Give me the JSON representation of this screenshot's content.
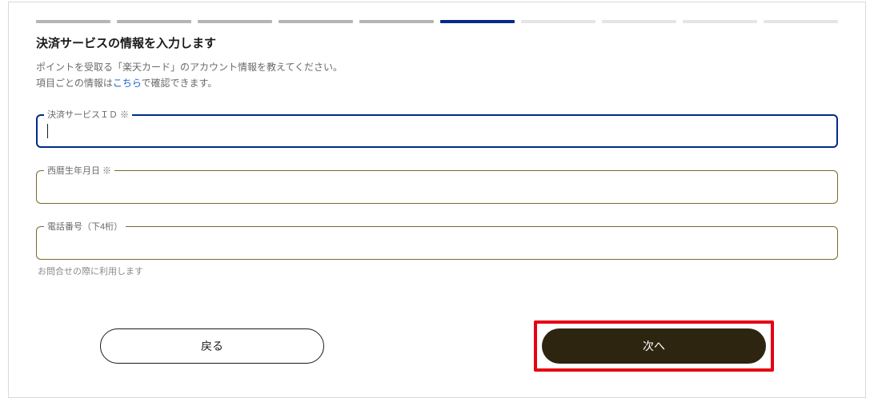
{
  "progress": {
    "total": 10,
    "current_index": 5
  },
  "title": "決済サービスの情報を入力します",
  "description": {
    "line1": "ポイントを受取る「楽天カード」のアカウント情報を教えてください。",
    "line2_prefix": "項目ごとの情報は",
    "line2_link": "こちら",
    "line2_suffix": "で確認できます。"
  },
  "fields": {
    "service_id": {
      "label": "決済サービスＩＤ ※",
      "value": ""
    },
    "birthdate": {
      "label": "西暦生年月日 ※",
      "value": ""
    },
    "phone": {
      "label": "電話番号（下4桁）",
      "value": "",
      "helper": "お問合せの際に利用します"
    }
  },
  "buttons": {
    "back": "戻る",
    "next": "次へ"
  }
}
